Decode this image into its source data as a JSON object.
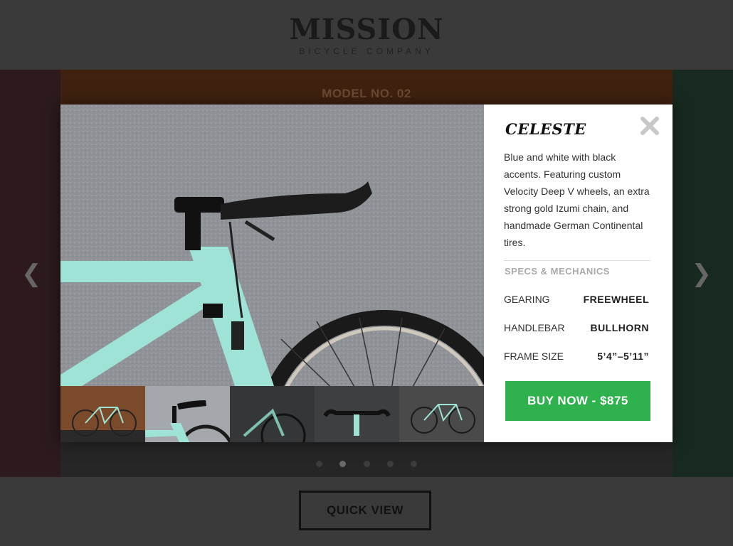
{
  "brand": {
    "name": "MISSION",
    "tagline": "BICYCLE COMPANY"
  },
  "background": {
    "model_label": "MODEL NO. 02",
    "active_dot": 2,
    "dot_count": 5
  },
  "nav": {
    "prev_icon": "chevron-left-icon",
    "next_icon": "chevron-right-icon"
  },
  "quick_view": {
    "label": "QUICK VIEW"
  },
  "modal": {
    "title": "CELESTE",
    "description": "Blue and white with black accents. Featuring custom Velocity Deep V wheels, an extra strong gold Izumi chain, and handmade German Continental tires.",
    "specs_heading": "SPECS & MECHANICS",
    "specs": [
      {
        "label": "GEARING",
        "value": "FREEWHEEL"
      },
      {
        "label": "HANDLEBAR",
        "value": "BULLHORN"
      },
      {
        "label": "FRAME SIZE",
        "value": "5’4”–5’11”"
      }
    ],
    "buy_label": "BUY NOW - $875",
    "selected_thumb": 2,
    "colors": {
      "accent": "#2fb24d",
      "frame": "#9fe3d6"
    }
  }
}
